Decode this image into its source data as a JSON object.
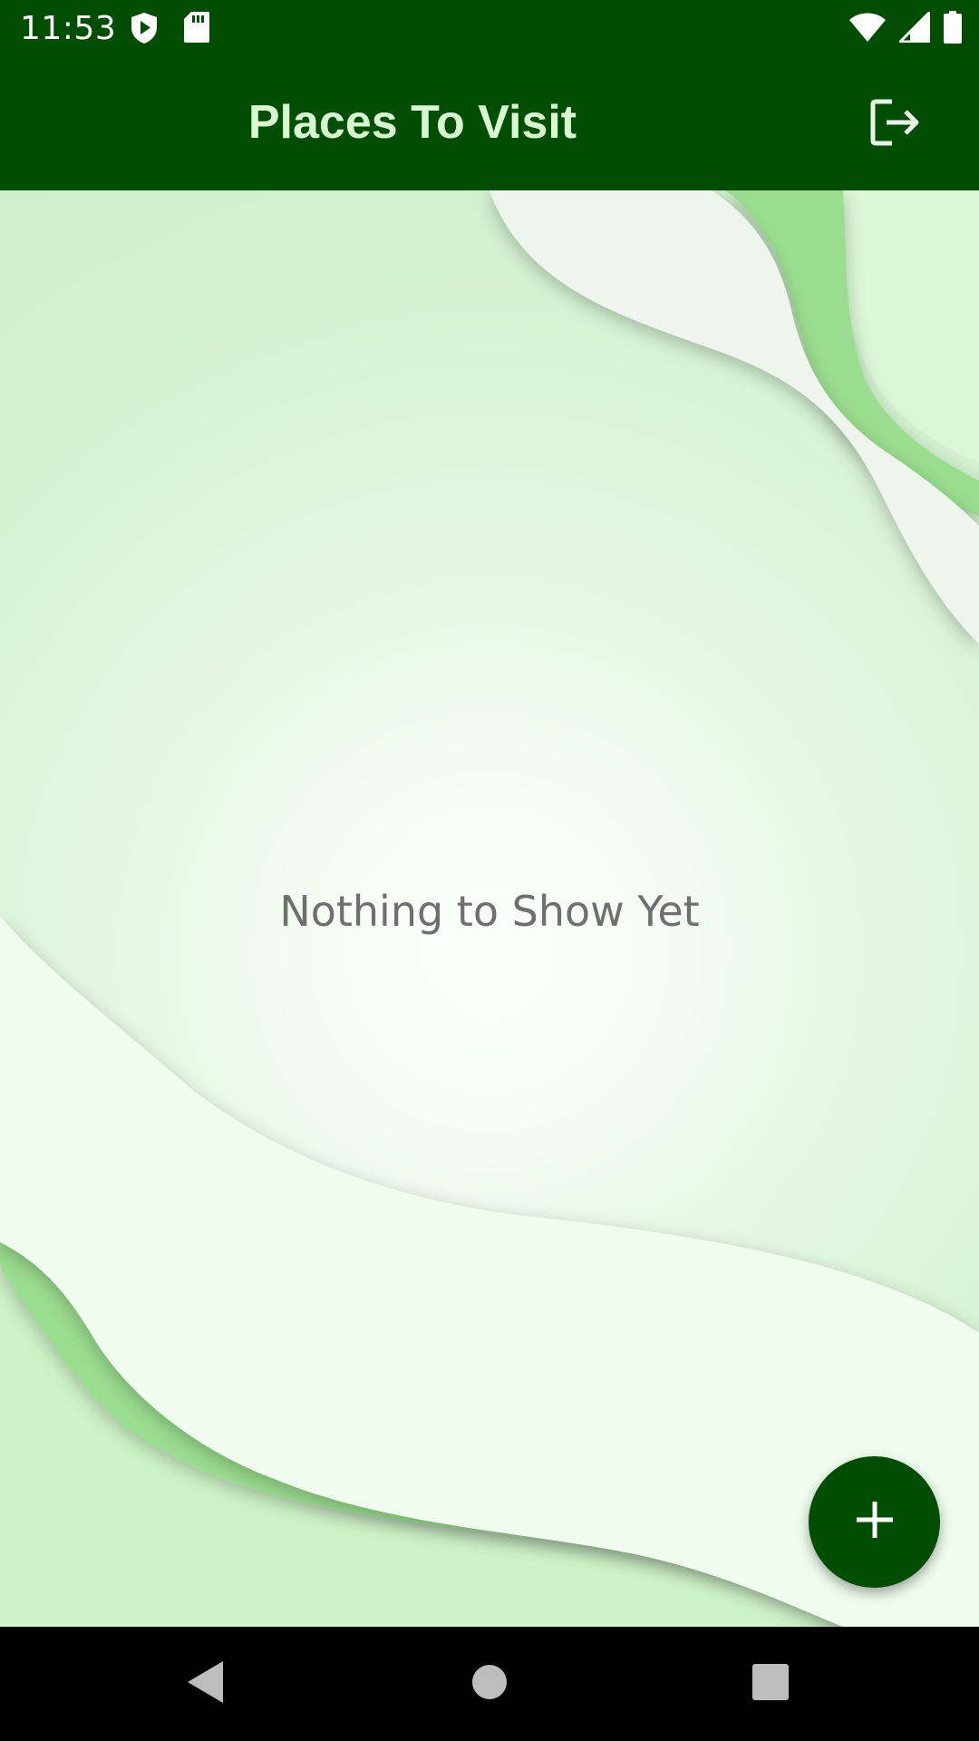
{
  "status_bar": {
    "time": "11:53",
    "icons": [
      "shield-play-icon",
      "sd-card-icon",
      "wifi-icon",
      "signal-icon",
      "battery-icon"
    ]
  },
  "app_bar": {
    "title": "Places To Visit",
    "action_icon": "logout-icon"
  },
  "main": {
    "empty_message": "Nothing to Show Yet"
  },
  "fab": {
    "icon": "plus-icon"
  },
  "nav_bar": {
    "icons": [
      "back-icon",
      "home-icon",
      "recents-icon"
    ]
  },
  "colors": {
    "primary": "#014d01",
    "title_text": "#d7f8d0",
    "background": "#d3f2d1",
    "empty_text": "#6f6f6f"
  }
}
